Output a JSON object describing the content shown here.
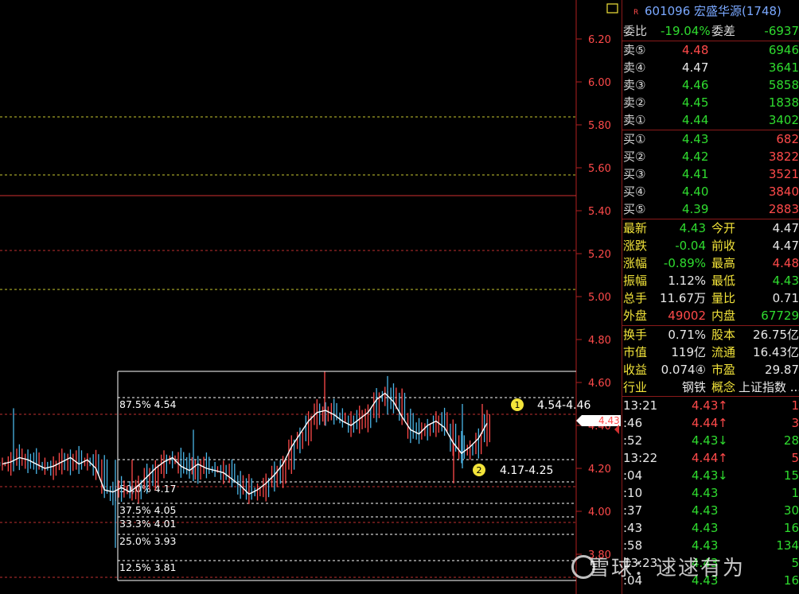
{
  "chart_data": {
    "type": "line",
    "title": "",
    "price_axis": {
      "ticks": [
        "6.20",
        "6.00",
        "5.80",
        "5.60",
        "5.40",
        "5.20",
        "5.00",
        "4.80",
        "4.60",
        "4.40",
        "4.20",
        "4.00",
        "3.80"
      ],
      "ylim": [
        3.78,
        6.3
      ]
    },
    "current_price_tag": "4.43",
    "fib_levels": [
      {
        "label": "87.5% 4.54"
      },
      {
        "label": "50.0% 4.17"
      },
      {
        "label": "37.5% 4.05"
      },
      {
        "label": "33.3% 4.01"
      },
      {
        "label": "25.0% 3.93"
      },
      {
        "label": "12.5% 3.81"
      }
    ],
    "annotations": [
      {
        "marker": "1",
        "text": "4.54-4.46"
      },
      {
        "marker": "2",
        "text": "4.17-4.25"
      }
    ],
    "close_series": [
      4.22,
      4.23,
      4.25,
      4.24,
      4.22,
      4.2,
      4.21,
      4.23,
      4.25,
      4.22,
      4.24,
      4.2,
      4.1,
      4.09,
      4.11,
      4.09,
      4.12,
      4.16,
      4.2,
      4.23,
      4.25,
      4.21,
      4.19,
      4.22,
      4.2,
      4.19,
      4.18,
      4.15,
      4.12,
      4.08,
      4.1,
      4.13,
      4.17,
      4.22,
      4.3,
      4.36,
      4.42,
      4.46,
      4.47,
      4.45,
      4.42,
      4.4,
      4.43,
      4.46,
      4.52,
      4.55,
      4.51,
      4.44,
      4.38,
      4.36,
      4.4,
      4.42,
      4.39,
      4.32,
      4.27,
      4.3,
      4.34,
      4.41
    ]
  },
  "quote": {
    "r_mark": "R",
    "title": "601096 宏盛华源(1748)",
    "wei_bi_label": "委比",
    "wei_bi": "-19.04%",
    "wei_cha_label": "委差",
    "wei_cha": "-6937",
    "sells": [
      {
        "label": "卖⑤",
        "price": "4.48",
        "vol": "6946",
        "pcolor": "red"
      },
      {
        "label": "卖④",
        "price": "4.47",
        "vol": "3641",
        "pcolor": "white"
      },
      {
        "label": "卖③",
        "price": "4.46",
        "vol": "5858",
        "pcolor": "green"
      },
      {
        "label": "卖②",
        "price": "4.45",
        "vol": "1838",
        "pcolor": "green"
      },
      {
        "label": "卖①",
        "price": "4.44",
        "vol": "3402",
        "pcolor": "green"
      }
    ],
    "buys": [
      {
        "label": "买①",
        "price": "4.43",
        "vol": "682"
      },
      {
        "label": "买②",
        "price": "4.42",
        "vol": "3822"
      },
      {
        "label": "买③",
        "price": "4.41",
        "vol": "3521"
      },
      {
        "label": "买④",
        "price": "4.40",
        "vol": "3840"
      },
      {
        "label": "买⑤",
        "price": "4.39",
        "vol": "2883"
      }
    ],
    "stats1": [
      {
        "l1": "最新",
        "v1": "4.43",
        "c1": "green",
        "l2": "今开",
        "v2": "4.47",
        "c2": "white"
      },
      {
        "l1": "涨跌",
        "v1": "-0.04",
        "c1": "green",
        "l2": "前收",
        "v2": "4.47",
        "c2": "white"
      },
      {
        "l1": "涨幅",
        "v1": "-0.89%",
        "c1": "green",
        "l2": "最高",
        "v2": "4.48",
        "c2": "red"
      },
      {
        "l1": "振幅",
        "v1": "1.12%",
        "c1": "white",
        "l2": "最低",
        "v2": "4.43",
        "c2": "green"
      },
      {
        "l1": "总手",
        "v1": "11.67万",
        "c1": "white",
        "l2": "量比",
        "v2": "0.71",
        "c2": "white"
      },
      {
        "l1": "外盘",
        "v1": "49002",
        "c1": "red",
        "l2": "内盘",
        "v2": "67729",
        "c2": "green"
      }
    ],
    "stats2": [
      {
        "l1": "换手",
        "v1": "0.71%",
        "l2": "股本",
        "v2": "26.75亿"
      },
      {
        "l1": "市值",
        "v1": "119亿",
        "l2": "流通",
        "v2": "16.43亿"
      },
      {
        "l1": "收益",
        "v1": "0.074④",
        "l2": "市盈",
        "v2": "29.87"
      }
    ],
    "industry_label": "行业",
    "industry": "钢铁",
    "concept_label": "概念",
    "concept": "上证指数 ..."
  },
  "ticks_list": [
    {
      "time": "13:21",
      "price": "4.43",
      "arrow": "↑",
      "acolor": "red",
      "vol": "1",
      "vcolor": "red"
    },
    {
      "time": ":46",
      "price": "4.44",
      "arrow": "↑",
      "acolor": "red",
      "vol": "3",
      "vcolor": "red"
    },
    {
      "time": ":52",
      "price": "4.43",
      "arrow": "↓",
      "acolor": "green",
      "vol": "28",
      "vcolor": "green"
    },
    {
      "time": "13:22",
      "price": "4.44",
      "arrow": "↑",
      "acolor": "red",
      "vol": "5",
      "vcolor": "red"
    },
    {
      "time": ":04",
      "price": "4.43",
      "arrow": "↓",
      "acolor": "green",
      "vol": "15",
      "vcolor": "green"
    },
    {
      "time": ":10",
      "price": "4.43",
      "arrow": "",
      "acolor": "green",
      "vol": "1",
      "vcolor": "green"
    },
    {
      "time": ":37",
      "price": "4.43",
      "arrow": "",
      "acolor": "green",
      "vol": "30",
      "vcolor": "green"
    },
    {
      "time": ":43",
      "price": "4.43",
      "arrow": "",
      "acolor": "green",
      "vol": "16",
      "vcolor": "green"
    },
    {
      "time": ":58",
      "price": "4.43",
      "arrow": "",
      "acolor": "green",
      "vol": "134",
      "vcolor": "green"
    },
    {
      "time": "13:23",
      "price": "4.43",
      "arrow": "",
      "acolor": "green",
      "vol": "5",
      "vcolor": "green"
    },
    {
      "time": ":04",
      "price": "4.43",
      "arrow": "",
      "acolor": "green",
      "vol": "16",
      "vcolor": "green"
    }
  ],
  "watermark": "雪球：逑逑有为",
  "colors": {
    "up": "#ff4a4a",
    "down": "#2fdc2f",
    "neutral": "#e8e8e8",
    "panel_border": "#8a1a1a"
  }
}
